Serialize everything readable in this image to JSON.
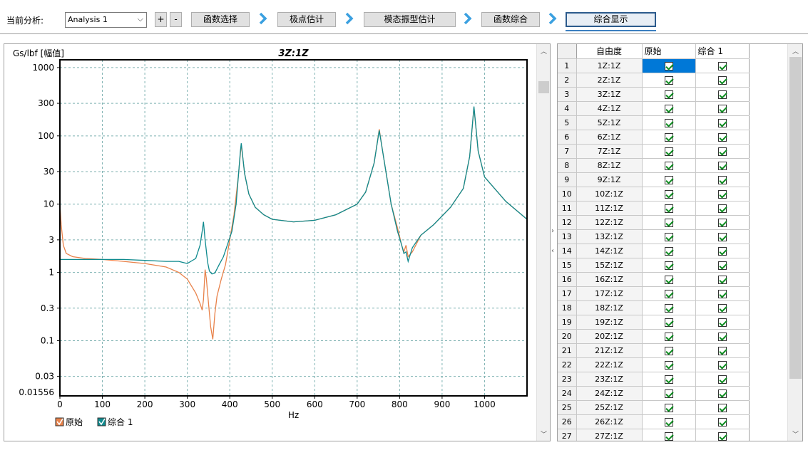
{
  "toolbar": {
    "label": "当前分析:",
    "analysis_value": "Analysis 1",
    "plus": "+",
    "minus": "-",
    "steps": [
      "函数选择",
      "极点估计",
      "模态振型估计",
      "函数综合",
      "综合显示"
    ]
  },
  "chart_data": {
    "type": "line",
    "title": "3Z:1Z",
    "ylabel": "Gs/lbf [幅值]",
    "xlabel": "Hz",
    "yscale": "log",
    "xlim": [
      0,
      1100
    ],
    "ylim": [
      0.01556,
      1300
    ],
    "x_ticks": [
      0,
      100,
      200,
      300,
      400,
      500,
      600,
      700,
      800,
      900,
      1000
    ],
    "y_ticks": [
      1000,
      300,
      100,
      30,
      10,
      3,
      1,
      0.3,
      0.1,
      0.03
    ],
    "y_tick_labels": [
      "1000",
      "300",
      "100",
      "30",
      "10",
      "3",
      "1",
      "0.3",
      "0.1",
      "0.03"
    ],
    "y_min_label": "0.01556",
    "grid": true,
    "legend_position": "bottom-left",
    "series": [
      {
        "name": "原始",
        "color": "#e8824a",
        "points": [
          [
            0,
            10
          ],
          [
            3,
            5
          ],
          [
            8,
            2.5
          ],
          [
            15,
            1.9
          ],
          [
            30,
            1.7
          ],
          [
            60,
            1.6
          ],
          [
            100,
            1.55
          ],
          [
            150,
            1.45
          ],
          [
            200,
            1.35
          ],
          [
            250,
            1.2
          ],
          [
            280,
            1.0
          ],
          [
            300,
            0.8
          ],
          [
            320,
            0.5
          ],
          [
            330,
            0.35
          ],
          [
            335,
            0.28
          ],
          [
            338,
            0.4
          ],
          [
            342,
            1.1
          ],
          [
            345,
            0.8
          ],
          [
            350,
            0.35
          ],
          [
            355,
            0.16
          ],
          [
            360,
            0.105
          ],
          [
            365,
            0.25
          ],
          [
            370,
            0.45
          ],
          [
            380,
            0.8
          ],
          [
            390,
            1.3
          ],
          [
            400,
            3
          ],
          [
            410,
            7
          ],
          [
            420,
            25
          ],
          [
            427,
            75
          ],
          [
            435,
            28
          ],
          [
            445,
            14
          ],
          [
            460,
            9
          ],
          [
            480,
            7
          ],
          [
            500,
            6
          ],
          [
            550,
            5.5
          ],
          [
            600,
            5.8
          ],
          [
            650,
            7
          ],
          [
            700,
            10
          ],
          [
            720,
            15
          ],
          [
            740,
            40
          ],
          [
            752,
            125
          ],
          [
            762,
            50
          ],
          [
            780,
            10
          ],
          [
            795,
            4.5
          ],
          [
            805,
            2.5
          ],
          [
            810,
            2
          ],
          [
            815,
            2.5
          ],
          [
            820,
            1.7
          ],
          [
            830,
            2
          ],
          [
            850,
            3.5
          ],
          [
            880,
            5
          ],
          [
            920,
            9
          ],
          [
            950,
            17
          ],
          [
            965,
            50
          ],
          [
            975,
            260
          ],
          [
            985,
            60
          ],
          [
            1000,
            25
          ],
          [
            1050,
            11
          ],
          [
            1100,
            6
          ]
        ]
      },
      {
        "name": "综合 1",
        "color": "#0f8a8e",
        "points": [
          [
            0,
            1.55
          ],
          [
            50,
            1.55
          ],
          [
            100,
            1.55
          ],
          [
            150,
            1.55
          ],
          [
            200,
            1.5
          ],
          [
            250,
            1.45
          ],
          [
            280,
            1.45
          ],
          [
            300,
            1.35
          ],
          [
            320,
            1.6
          ],
          [
            330,
            2.5
          ],
          [
            335,
            4
          ],
          [
            338,
            5.5
          ],
          [
            342,
            3
          ],
          [
            348,
            1.4
          ],
          [
            352,
            1.05
          ],
          [
            358,
            0.95
          ],
          [
            365,
            0.98
          ],
          [
            375,
            1.3
          ],
          [
            385,
            1.7
          ],
          [
            395,
            2.6
          ],
          [
            405,
            4
          ],
          [
            415,
            10
          ],
          [
            425,
            60
          ],
          [
            427,
            78
          ],
          [
            435,
            28
          ],
          [
            445,
            14
          ],
          [
            460,
            9
          ],
          [
            480,
            7
          ],
          [
            500,
            6
          ],
          [
            550,
            5.5
          ],
          [
            600,
            5.8
          ],
          [
            650,
            7
          ],
          [
            700,
            10
          ],
          [
            720,
            15
          ],
          [
            740,
            40
          ],
          [
            752,
            120
          ],
          [
            762,
            50
          ],
          [
            780,
            10
          ],
          [
            795,
            4
          ],
          [
            805,
            2.5
          ],
          [
            810,
            1.9
          ],
          [
            815,
            2
          ],
          [
            820,
            1.45
          ],
          [
            830,
            2.3
          ],
          [
            850,
            3.5
          ],
          [
            880,
            5
          ],
          [
            920,
            9
          ],
          [
            950,
            17
          ],
          [
            965,
            50
          ],
          [
            975,
            270
          ],
          [
            985,
            60
          ],
          [
            1000,
            25
          ],
          [
            1050,
            11
          ],
          [
            1100,
            6
          ]
        ]
      }
    ],
    "legend": [
      "原始",
      "综合 1"
    ]
  },
  "grid_table": {
    "headers": [
      "自由度",
      "原始",
      "综合 1"
    ],
    "rows": [
      {
        "n": "1",
        "dof": "1Z:1Z"
      },
      {
        "n": "2",
        "dof": "2Z:1Z"
      },
      {
        "n": "3",
        "dof": "3Z:1Z"
      },
      {
        "n": "4",
        "dof": "4Z:1Z"
      },
      {
        "n": "5",
        "dof": "5Z:1Z"
      },
      {
        "n": "6",
        "dof": "6Z:1Z"
      },
      {
        "n": "7",
        "dof": "7Z:1Z"
      },
      {
        "n": "8",
        "dof": "8Z:1Z"
      },
      {
        "n": "9",
        "dof": "9Z:1Z"
      },
      {
        "n": "10",
        "dof": "10Z:1Z"
      },
      {
        "n": "11",
        "dof": "11Z:1Z"
      },
      {
        "n": "12",
        "dof": "12Z:1Z"
      },
      {
        "n": "13",
        "dof": "13Z:1Z"
      },
      {
        "n": "14",
        "dof": "14Z:1Z"
      },
      {
        "n": "15",
        "dof": "15Z:1Z"
      },
      {
        "n": "16",
        "dof": "16Z:1Z"
      },
      {
        "n": "17",
        "dof": "17Z:1Z"
      },
      {
        "n": "18",
        "dof": "18Z:1Z"
      },
      {
        "n": "19",
        "dof": "19Z:1Z"
      },
      {
        "n": "20",
        "dof": "20Z:1Z"
      },
      {
        "n": "21",
        "dof": "21Z:1Z"
      },
      {
        "n": "22",
        "dof": "22Z:1Z"
      },
      {
        "n": "23",
        "dof": "23Z:1Z"
      },
      {
        "n": "24",
        "dof": "24Z:1Z"
      },
      {
        "n": "25",
        "dof": "25Z:1Z"
      },
      {
        "n": "26",
        "dof": "26Z:1Z"
      },
      {
        "n": "27",
        "dof": "27Z:1Z"
      }
    ],
    "selected_row": 1,
    "accent_color": "#0078d7"
  }
}
